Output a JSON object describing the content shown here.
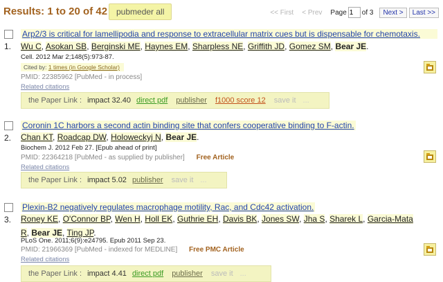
{
  "header": {
    "results_label": "Results: 1 to 20 of 42",
    "pubmeder_button": "pubmeder all",
    "pager": {
      "first": "<< First",
      "prev": "< Prev",
      "page_label": "Page",
      "page_value": "1",
      "of_label": "of 3",
      "next": "Next >",
      "last": "Last >>"
    }
  },
  "entries": [
    {
      "number": "1.",
      "title": "Arp2/3 is critical for lamellipodia and response to extracellular matrix cues but is dispensable for chemotaxis.",
      "authors": [
        "Wu C",
        "Asokan SB",
        "Berginski ME",
        "Haynes EM",
        "Sharpless NE",
        "Griffith JD",
        "Gomez SM"
      ],
      "author_bold": "Bear JE",
      "citation": "Cell. 2012 Mar 2;148(5):973-87.",
      "cited_by_label": "Cited by:",
      "cited_by_link": "1 times (in Google Scholar)",
      "pmid": "PMID: 22385962 [PubMed - in process]",
      "free": "",
      "related": "Related citations",
      "linkbar": {
        "label": "the Paper Link :",
        "impact": "impact 32.40",
        "pdf": "direct pdf",
        "publisher": "publisher",
        "f1000": "f1000 score 12",
        "save": "save it",
        "dots": "..."
      },
      "icon": "save-to-folder-icon"
    },
    {
      "number": "2.",
      "title": "Coronin 1C harbors a second actin binding site that confers cooperative binding to F-actin.",
      "authors": [
        "Chan KT",
        "Roadcap DW",
        "Holoweckyj N"
      ],
      "author_bold": "Bear JE",
      "citation": "Biochem J. 2012 Feb 27. [Epub ahead of print]",
      "pmid": "PMID: 22364218 [PubMed - as supplied by publisher]",
      "free": "Free Article",
      "related": "Related citations",
      "linkbar": {
        "label": "the Paper Link :",
        "impact": "impact 5.02",
        "publisher": "publisher",
        "save": "save it",
        "dots": "..."
      },
      "icon": "save-to-folder-icon"
    },
    {
      "number": "3.",
      "title": "Plexin-B2 negatively regulates macrophage motility, Rac, and Cdc42 activation.",
      "authors_line1": [
        "Roney KE",
        "O'Connor BP",
        "Wen H",
        "Holl EK",
        "Guthrie EH",
        "Davis BK",
        "Jones SW",
        "Jha S",
        "Sharek L",
        "Garcia-Mata"
      ],
      "authors_line2_pre": "R",
      "author_bold": "Bear JE",
      "authors_line2_post": "Ting JP",
      "citation": "PLoS One. 2011;6(9):e24795. Epub 2011 Sep 23.",
      "pmid": "PMID: 21966369 [PubMed - indexed for MEDLINE]",
      "free": "Free PMC Article",
      "related": "Related citations",
      "linkbar": {
        "label": "the Paper Link :",
        "impact": "impact 4.41",
        "pdf": "direct pdf",
        "publisher": "publisher",
        "save": "save it",
        "dots": "..."
      },
      "icon": "save-to-folder-icon"
    }
  ]
}
